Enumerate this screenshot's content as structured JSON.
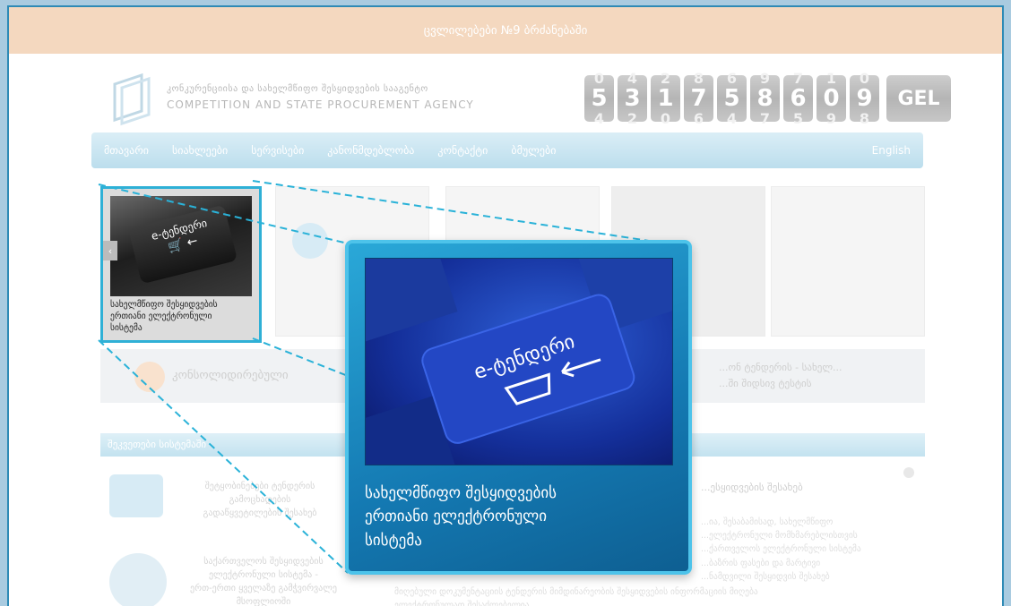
{
  "banner": {
    "text": "ცვლილებები №9 ბრძანებაში"
  },
  "agency": {
    "name_ka": "კონკურენციისა და სახელმწიფო შესყიდვების სააგენტო",
    "name_en": "COMPETITION AND STATE PROCUREMENT AGENCY"
  },
  "counter": {
    "digits": [
      "5",
      "3",
      "1",
      "7",
      "5",
      "8",
      "6",
      "0",
      "9"
    ],
    "ghost_top": [
      "0",
      "4",
      "2",
      "8",
      "6",
      "9",
      "7",
      "1",
      "0"
    ],
    "ghost_bottom": [
      "4",
      "2",
      "0",
      "6",
      "4",
      "7",
      "5",
      "9",
      "8"
    ],
    "currency": "GEL"
  },
  "nav": {
    "items": [
      "მთავარი",
      "სიახლეები",
      "სერვისები",
      "კანონმდებლობა",
      "კონტაქტი",
      "ბმულები"
    ],
    "english": "English"
  },
  "slider": {
    "left_arrow": "‹",
    "featured_caption_lines": [
      "სახელმწიფო შესყიდვების",
      "ერთიანი ელექტრონული",
      "სისტემა"
    ],
    "key_text": "e-ტენდერი",
    "thumb_labels": [
      "",
      "",
      "",
      ""
    ],
    "logo_mini_text": "სახელმწიფო\nშესყიდვების"
  },
  "promo": {
    "left": "კონსოლიდირებული",
    "right_line1": "...ონ ტენდერის - სახელ...",
    "right_line2": "...ში შიდსივ ტესტის"
  },
  "section": {
    "title": "შეკვეთები სისტემაში"
  },
  "items": [
    {
      "text": "შეტყობინებები ტენდერის\nგამოცხადების\nგადაწყვეტილების შესახებ"
    },
    {
      "text": "საქართველოს შესყიდვების\nელექტრონული სისტემა -\nერთ-ერთი ყველაზე გამჭვირვალე\nმსოფლიოში"
    }
  ],
  "right_column": {
    "heading": "...ესყიდვების შესახებ",
    "body": "...ია, შესაბამისად, სახელმწიფო\n...ელექტრონული მომხმარებლისთვის\n...ქართველოს ელექტრონული სისტემა\n...ბაზრის ფასები და მარტივი\n...ნამდვილი შესყიდვის შესახებ"
  },
  "bottom_text": "მიღებული დოკუმენტაციის ტენდერის მიმდინარეობის შესყიდვების ინფორმაციის მიღება\nელექტრონულად შესაძლებელია",
  "colors": {
    "frame": "#2e8ab5",
    "callout": "#1479b2",
    "accent": "#4dc3ea",
    "banner": "#f4d8bf"
  }
}
